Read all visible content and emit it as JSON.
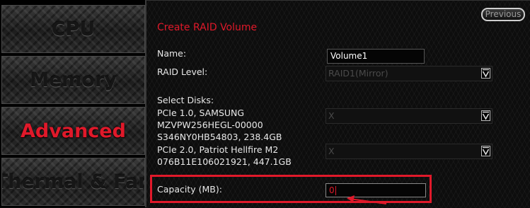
{
  "sidebar": {
    "tabs": [
      {
        "label": "CPU"
      },
      {
        "label": "Memory"
      },
      {
        "label": "Advanced",
        "active": true
      },
      {
        "label": "Thermal & Fan"
      }
    ]
  },
  "header": {
    "previous_label": "Previous",
    "title": "Create RAID Volume"
  },
  "form": {
    "name_label": "Name:",
    "name_value": "Volume1",
    "raid_level_label": "RAID Level:",
    "raid_level_value": "RAID1(Mirror)",
    "select_disks_label": "Select Disks:",
    "disk1_line1": "PCIe 1.0, SAMSUNG",
    "disk1_line2": "MZVPW256HEGL-00000",
    "disk1_line3": "S346NY0HB54803, 238.4GB",
    "disk1_value": "X",
    "disk2_line1": "PCIe 2.0, Patriot Hellfire M2",
    "disk2_line2": "076B11E106021921, 447.1GB",
    "disk2_value": "X",
    "capacity_label": "Capacity (MB):",
    "capacity_value": "0"
  },
  "colors": {
    "accent": "#e0192a",
    "text": "#e8e8e8",
    "disabled_text": "#4a4a4a"
  },
  "icons": [
    "chevron-down-icon",
    "pointer-arrow-icon"
  ]
}
